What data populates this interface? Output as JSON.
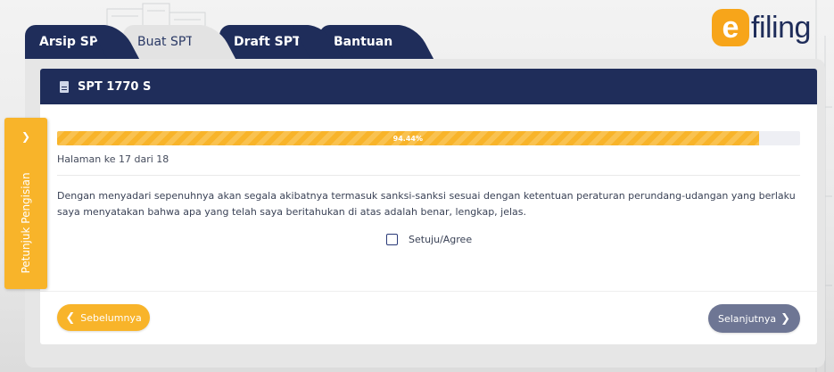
{
  "tabs": [
    {
      "label": "Arsip SPT"
    },
    {
      "label": "Buat SPT"
    },
    {
      "label": "Draft SPT"
    },
    {
      "label": "Bantuan"
    }
  ],
  "logo": {
    "mark": "e",
    "word": "filing"
  },
  "card": {
    "title": "SPT 1770 S"
  },
  "progress": {
    "label": "94.44%",
    "percent": 94.44
  },
  "page_info": "Halaman ke 17 dari 18",
  "statement": "Dengan menyadari sepenuhnya akan segala akibatnya termasuk sanksi-sanksi sesuai dengan ketentuan peraturan perundang-udangan yang berlaku saya menyatakan bahwa apa yang telah saya beritahukan di atas adalah benar, lengkap, jelas.",
  "agree": {
    "label": "Setuju/Agree",
    "checked": false
  },
  "buttons": {
    "prev": "Sebelumnya",
    "next": "Selanjutnya"
  },
  "side_panel": {
    "label": "Petunjuk Pengisian"
  },
  "colors": {
    "navy": "#1f2d5a",
    "accent": "#f8b42a",
    "next_button": "#6e7694"
  }
}
